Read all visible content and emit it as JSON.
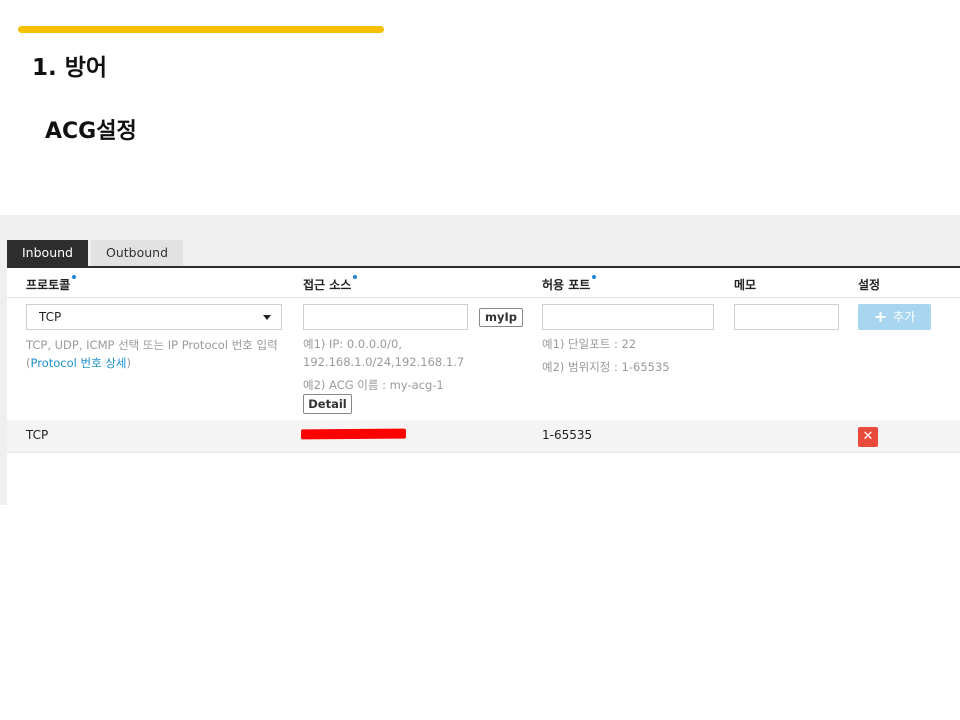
{
  "slide": {
    "title": "1. 방어",
    "subtitle": "ACG설정",
    "accent_color": "#f5c000"
  },
  "tabs": [
    {
      "label": "Inbound",
      "active": true
    },
    {
      "label": "Outbound",
      "active": false
    }
  ],
  "columns": {
    "protocol": "프로토콜",
    "source": "접근 소스",
    "port": "허용 포트",
    "memo": "메모",
    "settings": "설정"
  },
  "form": {
    "protocol_select": "TCP",
    "protocol_help_line1": "TCP, UDP, ICMP 선택 또는 IP Protocol 번호 입력",
    "protocol_help_open": "(",
    "protocol_help_link": "Protocol 번호 상세",
    "protocol_help_close": ")",
    "source_value": "",
    "myip_label": "myIp",
    "source_help_line1": "예1) IP: 0.0.0.0/0,",
    "source_help_line2": "192.168.1.0/24,192.168.1.7",
    "source_help_line3": "예2) ACG 이름 : my-acg-1",
    "detail_label": "Detail",
    "port_value": "",
    "port_help_line1": "예1) 단일포트 : 22",
    "port_help_line2": "예2) 범위지정 : 1-65535",
    "memo_value": "",
    "add_label": "추가",
    "add_icon": "plus-icon"
  },
  "rules": [
    {
      "protocol": "TCP",
      "source": "[redacted]",
      "port": "1-65535",
      "memo": "",
      "delete_icon": "close-icon"
    }
  ]
}
